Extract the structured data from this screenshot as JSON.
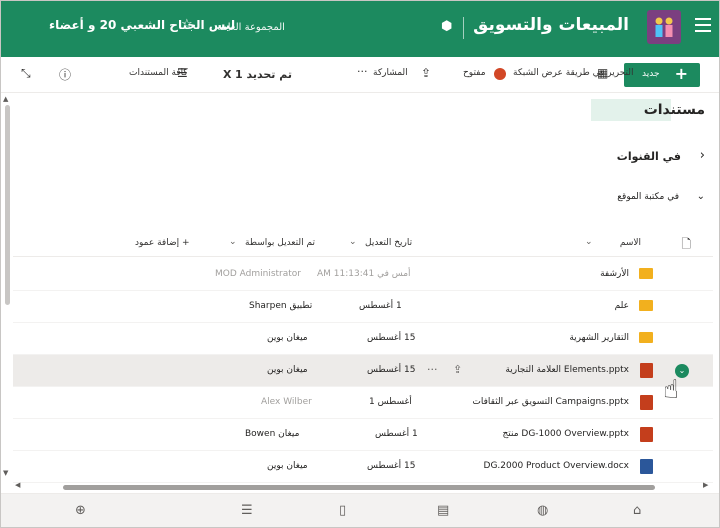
{
  "header": {
    "title": "المبيعات والتسويق",
    "group_label": "المجموعة العامة",
    "members": "ليس الجناح الشعبي 20 و أعضاء",
    "colors": {
      "brand": "#1c8a5f",
      "logo": "#7b3f80"
    }
  },
  "commands": {
    "new": "جديد",
    "edit_grid": "التحرير في طريقة عرض الشبكة",
    "open": "مفتوح",
    "share": "المشاركة",
    "more": "···",
    "selected": "تم تحديد 1",
    "close_x": "X",
    "all_docs": "كافة المستندات"
  },
  "library": {
    "title": "مستندات",
    "crumb_channels": "في القنوات",
    "crumb_site": "في مكتبة الموقع"
  },
  "columns": {
    "name": "الاسم",
    "modified": "تاريخ التعديل",
    "modified_by": "تم التعديل بواسطة",
    "add_column": "+ إضافة عمود"
  },
  "rows": [
    {
      "type": "folder",
      "name": "الأرشفة",
      "date": "أمس في  11:13:41 AM",
      "by": "MOD Administrator"
    },
    {
      "type": "folder",
      "name": "علم",
      "date": "1 أغسطس",
      "by": "تطبيق Sharpen"
    },
    {
      "type": "folder",
      "name": "التقارير الشهرية",
      "date": "15 أغسطس",
      "by": "ميغان بوين"
    },
    {
      "type": "ppt",
      "name": "Elements.pptx العلامة التجارية",
      "date": "15 أغسطس",
      "by": "ميغان بوين",
      "selected": true
    },
    {
      "type": "ppt",
      "name": "Campaigns.pptx التسويق عبر الثقافات",
      "date": "أغسطس 1",
      "by": "Alex Wilber"
    },
    {
      "type": "ppt",
      "name": "DG-1000 Overview.pptx منتج",
      "date": "1 أغسطس",
      "by": "ميغان Bowen"
    },
    {
      "type": "word",
      "name": "DG.2000 Product Overview.docx",
      "date": "15 أغسطس",
      "by": "ميغان بوين"
    }
  ],
  "icons": {
    "menu": "hamburger-icon",
    "teams": "teams-icon",
    "star": "star-icon",
    "info": "info-icon",
    "expand": "expand-icon",
    "grid": "grid-icon",
    "list": "list-icon",
    "home": "home-icon",
    "globe": "globe-icon",
    "news": "news-icon",
    "files": "files-icon",
    "db": "database-icon",
    "add": "add-icon"
  }
}
